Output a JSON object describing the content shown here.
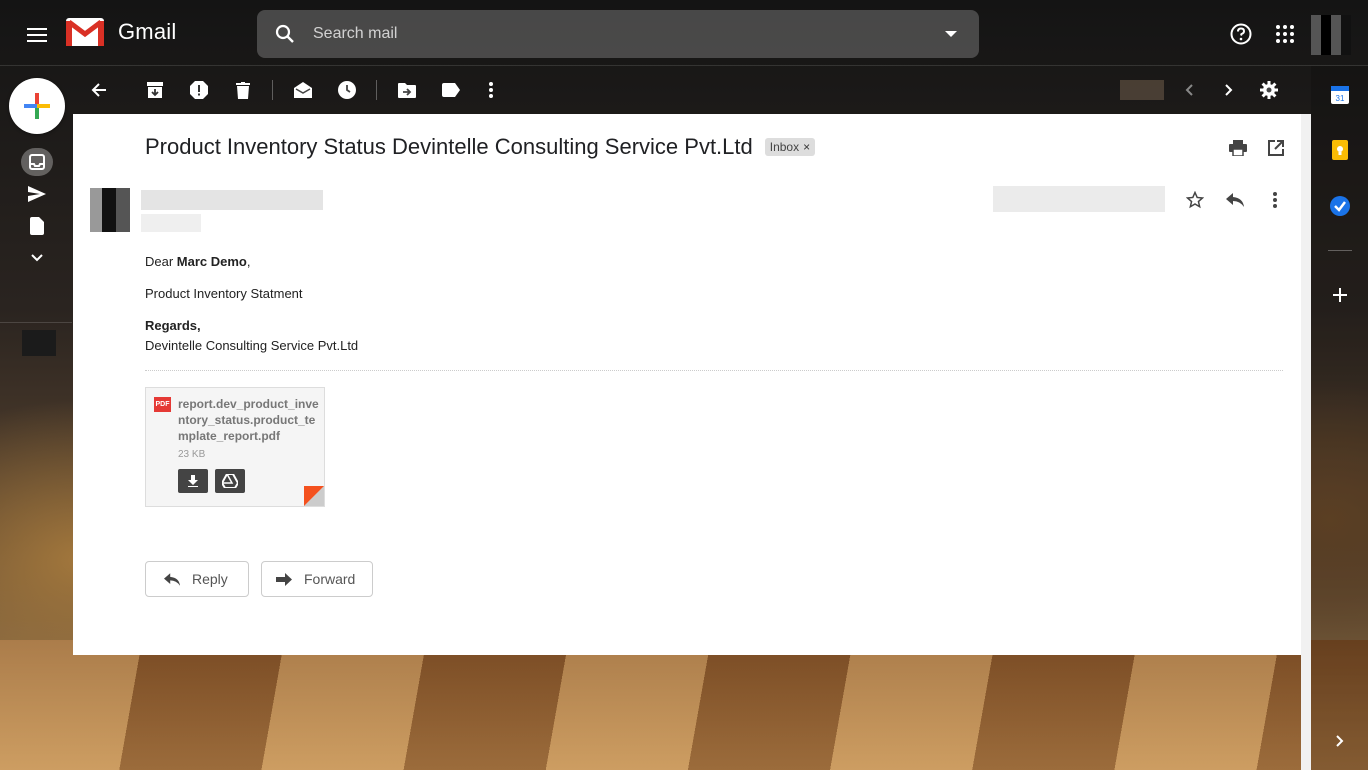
{
  "app": {
    "name": "Gmail"
  },
  "search": {
    "placeholder": "Search mail"
  },
  "email": {
    "subject": "Product Inventory Status Devintelle Consulting Service Pvt.Ltd",
    "label": "Inbox",
    "label_remove": "×",
    "greeting_prefix": "Dear ",
    "recipient_name": "Marc Demo",
    "greeting_suffix": ",",
    "body_line": "Product Inventory Statment",
    "sign_off": "Regards,",
    "company": "Devintelle Consulting Service Pvt.Ltd"
  },
  "attachment": {
    "type_badge": "PDF",
    "filename": "report.dev_product_inventory_status.product_template_report.pdf",
    "size": "23 KB"
  },
  "actions": {
    "reply_label": "Reply",
    "forward_label": "Forward"
  },
  "colors": {
    "pdf_red": "#e53935",
    "corner_orange": "#f4511e",
    "calendar_blue": "#1a73e8",
    "keep_yellow": "#fbbc04"
  },
  "icons": [
    "menu-icon",
    "gmail-logo",
    "search-icon",
    "dropdown-arrow-icon",
    "help-icon",
    "apps-grid-icon",
    "compose-plus-icon",
    "inbox-icon",
    "send-icon",
    "draft-icon",
    "expand-more-icon",
    "back-arrow-icon",
    "archive-icon",
    "report-spam-icon",
    "delete-icon",
    "mark-unread-icon",
    "snooze-icon",
    "move-to-icon",
    "label-icon",
    "more-vert-icon",
    "prev-icon",
    "next-icon",
    "settings-icon",
    "print-icon",
    "open-new-window-icon",
    "star-icon",
    "reply-icon",
    "download-icon",
    "drive-icon",
    "forward-icon",
    "calendar-icon",
    "keep-icon",
    "tasks-icon",
    "add-icon",
    "expand-right-icon"
  ]
}
